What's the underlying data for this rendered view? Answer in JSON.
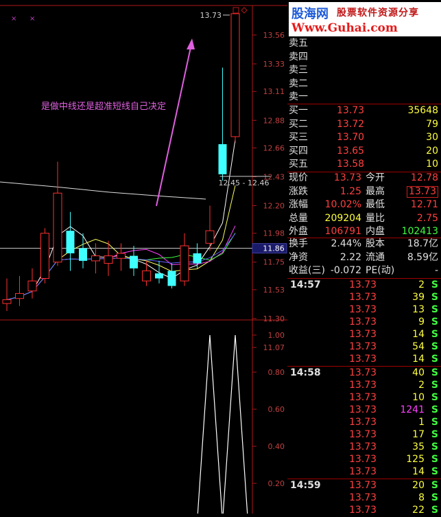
{
  "logo": {
    "name": "股海网",
    "subtitle": "股票软件资源分享",
    "url": "Www.Guhai.com"
  },
  "chart_data": [
    {
      "type": "candlestick",
      "title": "",
      "annotation": "是做中线还是超准短线自己决定",
      "price_axis_ticks": [
        "13.56",
        "13.33",
        "13.11",
        "12.88",
        "12.66",
        "12.43",
        "12.20",
        "11.98",
        "11.75",
        "11.53",
        "11.30",
        "11.07"
      ],
      "ylim": [
        10.95,
        13.75
      ],
      "current_line_label": "11.86",
      "current_line_value": 11.86,
      "high_label": "13.73",
      "range_label": "12.45 - 12.46",
      "candles": [
        {
          "o": 11.42,
          "h": 11.62,
          "l": 11.36,
          "c": 11.45
        },
        {
          "o": 11.46,
          "h": 11.64,
          "l": 11.4,
          "c": 11.5
        },
        {
          "o": 11.52,
          "h": 11.7,
          "l": 11.46,
          "c": 11.6
        },
        {
          "o": 11.62,
          "h": 12.02,
          "l": 11.58,
          "c": 11.98
        },
        {
          "o": 11.75,
          "h": 12.55,
          "l": 11.72,
          "c": 12.3
        },
        {
          "o": 12.0,
          "h": 12.15,
          "l": 11.68,
          "c": 11.82
        },
        {
          "o": 11.86,
          "h": 11.98,
          "l": 11.7,
          "c": 11.76
        },
        {
          "o": 11.76,
          "h": 11.9,
          "l": 11.66,
          "c": 11.8
        },
        {
          "o": 11.74,
          "h": 11.92,
          "l": 11.64,
          "c": 11.8
        },
        {
          "o": 11.78,
          "h": 11.9,
          "l": 11.68,
          "c": 11.82
        },
        {
          "o": 11.8,
          "h": 11.88,
          "l": 11.64,
          "c": 11.7
        },
        {
          "o": 11.6,
          "h": 11.76,
          "l": 11.56,
          "c": 11.68
        },
        {
          "o": 11.66,
          "h": 11.76,
          "l": 11.58,
          "c": 11.62
        },
        {
          "o": 11.68,
          "h": 11.74,
          "l": 11.54,
          "c": 11.56
        },
        {
          "o": 11.6,
          "h": 11.98,
          "l": 11.56,
          "c": 11.88
        },
        {
          "o": 11.82,
          "h": 11.9,
          "l": 11.7,
          "c": 11.74
        },
        {
          "o": 11.9,
          "h": 12.2,
          "l": 11.84,
          "c": 12.0
        },
        {
          "o": 12.69,
          "h": 13.3,
          "l": 12.4,
          "c": 12.45
        },
        {
          "o": 12.75,
          "h": 13.73,
          "l": 12.7,
          "c": 13.73
        }
      ],
      "sub_axis_ticks": [
        "1.00",
        "0.80",
        "0.60",
        "0.40",
        "0.20"
      ],
      "sub_series": [
        0,
        0,
        0,
        0,
        0,
        0,
        0,
        0,
        0,
        0,
        0,
        0,
        0,
        0,
        0,
        0,
        1.0,
        0,
        1.0,
        0
      ]
    }
  ],
  "quote": {
    "sell": [
      {
        "label": "卖五",
        "price": "",
        "vol": ""
      },
      {
        "label": "卖四",
        "price": "",
        "vol": ""
      },
      {
        "label": "卖三",
        "price": "",
        "vol": ""
      },
      {
        "label": "卖二",
        "price": "",
        "vol": ""
      },
      {
        "label": "卖一",
        "price": "",
        "vol": ""
      }
    ],
    "buy": [
      {
        "label": "买一",
        "price": "13.73",
        "vol": "35648"
      },
      {
        "label": "买二",
        "price": "13.72",
        "vol": "79"
      },
      {
        "label": "买三",
        "price": "13.70",
        "vol": "30"
      },
      {
        "label": "买四",
        "price": "13.65",
        "vol": "20"
      },
      {
        "label": "买五",
        "price": "13.58",
        "vol": "10"
      }
    ],
    "stats": [
      {
        "l1": "现价",
        "v1": "13.73",
        "c1": "r",
        "l2": "今开",
        "v2": "12.78",
        "c2": "r",
        "box": false
      },
      {
        "l1": "涨跌",
        "v1": "1.25",
        "c1": "r",
        "l2": "最高",
        "v2": "13.73",
        "c2": "r",
        "box": true
      },
      {
        "l1": "涨幅",
        "v1": "10.02%",
        "c1": "r",
        "l2": "最低",
        "v2": "12.71",
        "c2": "r",
        "box": false
      },
      {
        "l1": "总量",
        "v1": "209204",
        "c1": "y",
        "l2": "量比",
        "v2": "2.75",
        "c2": "r",
        "box": false
      },
      {
        "l1": "外盘",
        "v1": "106791",
        "c1": "r",
        "l2": "内盘",
        "v2": "102413",
        "c2": "g",
        "box": false
      }
    ],
    "stats2": [
      {
        "l1": "换手",
        "v1": "2.44%",
        "l2": "股本",
        "v2": "18.7亿"
      },
      {
        "l1": "净资",
        "v1": "2.22",
        "l2": "流通",
        "v2": "8.59亿"
      },
      {
        "l1": "收益(三)",
        "v1": "-0.072",
        "l2": "PE(动)",
        "v2": "-"
      }
    ]
  },
  "ticks": [
    {
      "time": "14:57",
      "price": "13.73",
      "vol": "2",
      "side": "S",
      "volc": "y"
    },
    {
      "time": "",
      "price": "13.73",
      "vol": "39",
      "side": "S",
      "volc": "y"
    },
    {
      "time": "",
      "price": "13.73",
      "vol": "13",
      "side": "S",
      "volc": "y"
    },
    {
      "time": "",
      "price": "13.73",
      "vol": "9",
      "side": "S",
      "volc": "y"
    },
    {
      "time": "",
      "price": "13.73",
      "vol": "14",
      "side": "S",
      "volc": "y"
    },
    {
      "time": "",
      "price": "13.73",
      "vol": "54",
      "side": "S",
      "volc": "y"
    },
    {
      "time": "",
      "price": "13.73",
      "vol": "14",
      "side": "S",
      "volc": "y"
    },
    {
      "time": "14:58",
      "price": "13.73",
      "vol": "40",
      "side": "S",
      "volc": "y"
    },
    {
      "time": "",
      "price": "13.73",
      "vol": "2",
      "side": "S",
      "volc": "y"
    },
    {
      "time": "",
      "price": "13.73",
      "vol": "10",
      "side": "S",
      "volc": "y"
    },
    {
      "time": "",
      "price": "13.73",
      "vol": "1241",
      "side": "S",
      "volc": "m"
    },
    {
      "time": "",
      "price": "13.73",
      "vol": "1",
      "side": "S",
      "volc": "y"
    },
    {
      "time": "",
      "price": "13.73",
      "vol": "17",
      "side": "S",
      "volc": "y"
    },
    {
      "time": "",
      "price": "13.73",
      "vol": "35",
      "side": "S",
      "volc": "y"
    },
    {
      "time": "",
      "price": "13.73",
      "vol": "125",
      "side": "S",
      "volc": "y"
    },
    {
      "time": "",
      "price": "13.73",
      "vol": "14",
      "side": "S",
      "volc": "y"
    },
    {
      "time": "14:59",
      "price": "13.73",
      "vol": "20",
      "side": "S",
      "volc": "y"
    },
    {
      "time": "",
      "price": "13.73",
      "vol": "8",
      "side": "S",
      "volc": "y"
    },
    {
      "time": "",
      "price": "13.73",
      "vol": "22",
      "side": "S",
      "volc": "y"
    }
  ],
  "colors": {
    "up": "#ff3030",
    "down": "#40ffff",
    "axis": "#b01818",
    "text": "#d0d0d0",
    "annotation": "#e060e0"
  }
}
